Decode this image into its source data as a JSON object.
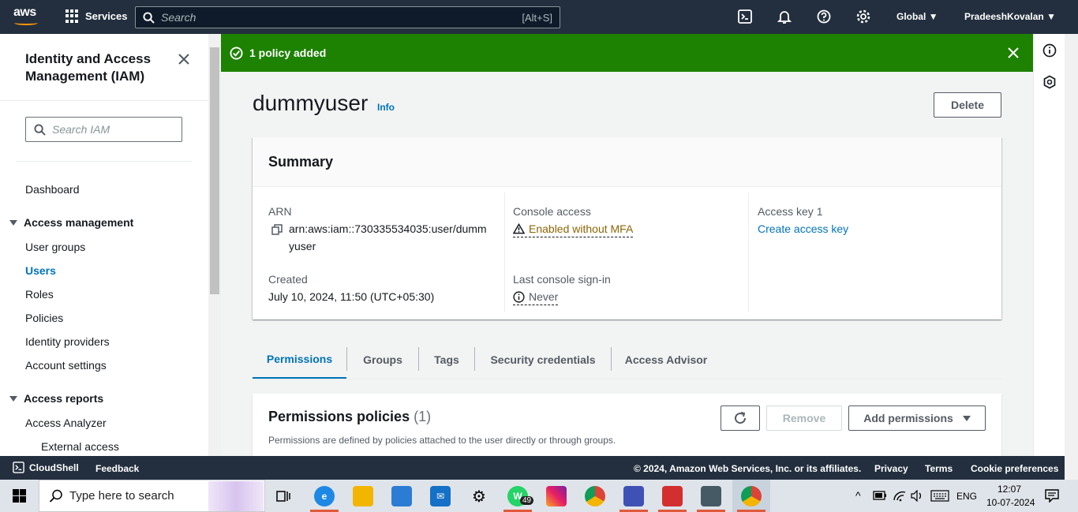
{
  "topnav": {
    "logo_text": "aws",
    "services_label": "Services",
    "search_placeholder": "Search",
    "search_shortcut": "[Alt+S]",
    "region": "Global",
    "account": "PradeeshKovalan"
  },
  "sidebar": {
    "title": "Identity and Access Management (IAM)",
    "search_placeholder": "Search IAM",
    "dashboard": "Dashboard",
    "section_access_mgmt": "Access management",
    "items": [
      "User groups",
      "Users",
      "Roles",
      "Policies",
      "Identity providers",
      "Account settings"
    ],
    "section_access_reports": "Access reports",
    "reports": [
      "Access Analyzer",
      "External access"
    ]
  },
  "flash": {
    "message": "1 policy added"
  },
  "page": {
    "title": "dummyuser",
    "info": "Info",
    "delete": "Delete"
  },
  "summary": {
    "heading": "Summary",
    "arn_label": "ARN",
    "arn_line1": "arn:aws:iam::730335534035:user/dumm",
    "arn_line2": "yuser",
    "created_label": "Created",
    "created_value": "July 10, 2024, 11:50 (UTC+05:30)",
    "console_label": "Console access",
    "console_value": "Enabled without MFA",
    "signin_label": "Last console sign-in",
    "signin_value": "Never",
    "accesskey_label": "Access key 1",
    "accesskey_value": "Create access key"
  },
  "tabs": [
    "Permissions",
    "Groups",
    "Tags",
    "Security credentials",
    "Access Advisor"
  ],
  "permissions": {
    "heading": "Permissions policies",
    "count": "(1)",
    "description": "Permissions are defined by policies attached to the user directly or through groups.",
    "remove": "Remove",
    "add": "Add permissions"
  },
  "footer": {
    "cloudshell": "CloudShell",
    "feedback": "Feedback",
    "copyright": "© 2024, Amazon Web Services, Inc. or its affiliates.",
    "privacy": "Privacy",
    "terms": "Terms",
    "cookies": "Cookie preferences"
  },
  "taskbar": {
    "search_text": "Type here to search",
    "whatsapp_badge": "49",
    "lang": "ENG",
    "time": "12:07",
    "date": "10-07-2024"
  },
  "colors": {
    "nav_bg": "#232f3e",
    "flash_green": "#1d8102",
    "link_blue": "#0073bb",
    "warning": "#8d6605",
    "aws_orange": "#ff9900"
  }
}
